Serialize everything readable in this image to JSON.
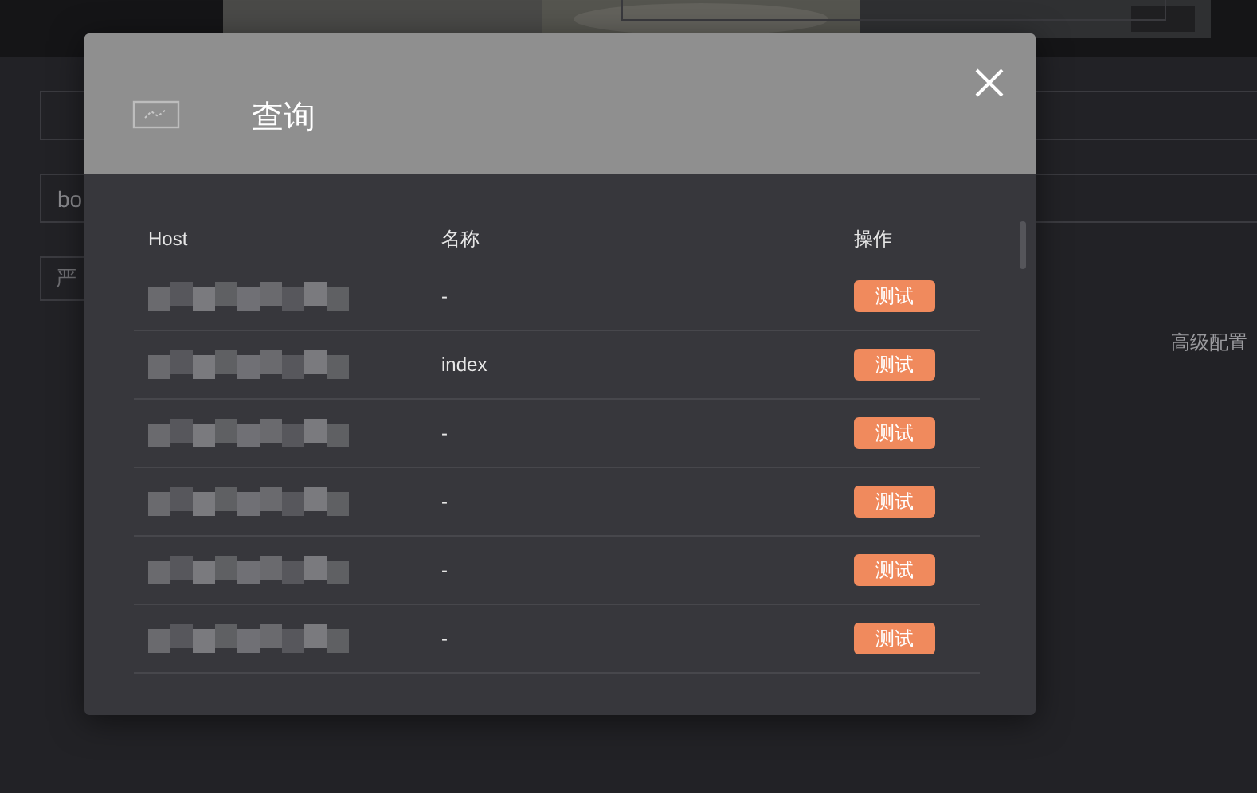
{
  "page": {
    "search_value": "bo",
    "filter_button": "严",
    "advanced_link": "高级配置"
  },
  "dialog": {
    "title": "查询",
    "columns": [
      "Host",
      "名称",
      "操作"
    ],
    "rows": [
      {
        "host_redacted": true,
        "name": "-",
        "action": "测试"
      },
      {
        "host_redacted": true,
        "name": "index",
        "action": "测试"
      },
      {
        "host_redacted": true,
        "name": "-",
        "action": "测试"
      },
      {
        "host_redacted": true,
        "name": "-",
        "action": "测试"
      },
      {
        "host_redacted": true,
        "name": "-",
        "action": "测试"
      },
      {
        "host_redacted": true,
        "name": "-",
        "action": "测试"
      }
    ]
  }
}
